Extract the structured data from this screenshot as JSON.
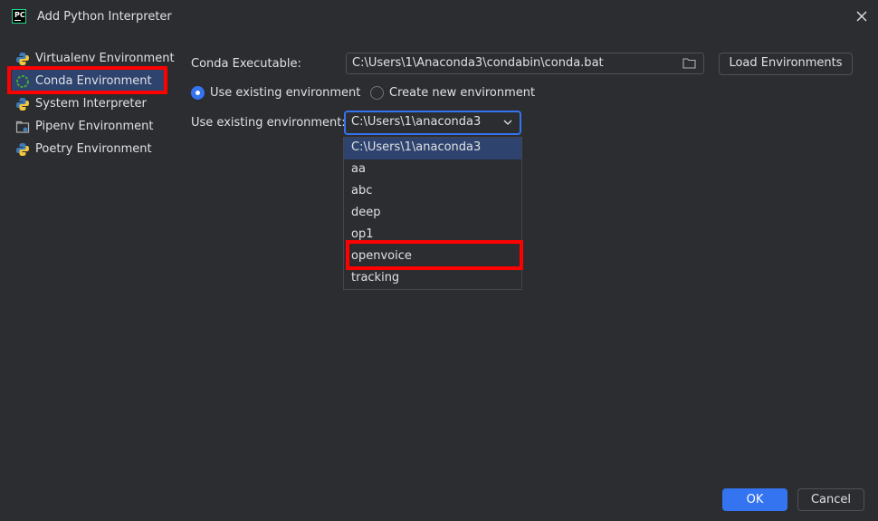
{
  "window": {
    "title": "Add Python Interpreter",
    "logo_text": "PC"
  },
  "sidebar": {
    "items": [
      {
        "label": "Virtualenv Environment",
        "icon": "python-icon",
        "selected": false
      },
      {
        "label": "Conda Environment",
        "icon": "conda-icon",
        "selected": true
      },
      {
        "label": "System Interpreter",
        "icon": "python-icon",
        "selected": false
      },
      {
        "label": "Pipenv Environment",
        "icon": "pipenv-icon",
        "selected": false
      },
      {
        "label": "Poetry Environment",
        "icon": "poetry-icon",
        "selected": false
      }
    ]
  },
  "form": {
    "conda_executable_label": "Conda Executable:",
    "conda_executable_value": "C:\\Users\\1\\Anaconda3\\condabin\\conda.bat",
    "load_environments_label": "Load Environments",
    "radio_existing_label": "Use existing environment",
    "radio_new_label": "Create new environment",
    "radio_selected": "existing",
    "existing_env_label": "Use existing environment:",
    "existing_env_value": "C:\\Users\\1\\anaconda3"
  },
  "dropdown": {
    "options": [
      "C:\\Users\\1\\anaconda3",
      "aa",
      "abc",
      "deep",
      "op1",
      "openvoice",
      "tracking"
    ],
    "selected_index": 0
  },
  "buttons": {
    "ok": "OK",
    "cancel": "Cancel"
  },
  "colors": {
    "background": "#2b2d30",
    "accent": "#3574f0",
    "selection": "#2e436e",
    "highlight_annotation": "#ff0000"
  }
}
